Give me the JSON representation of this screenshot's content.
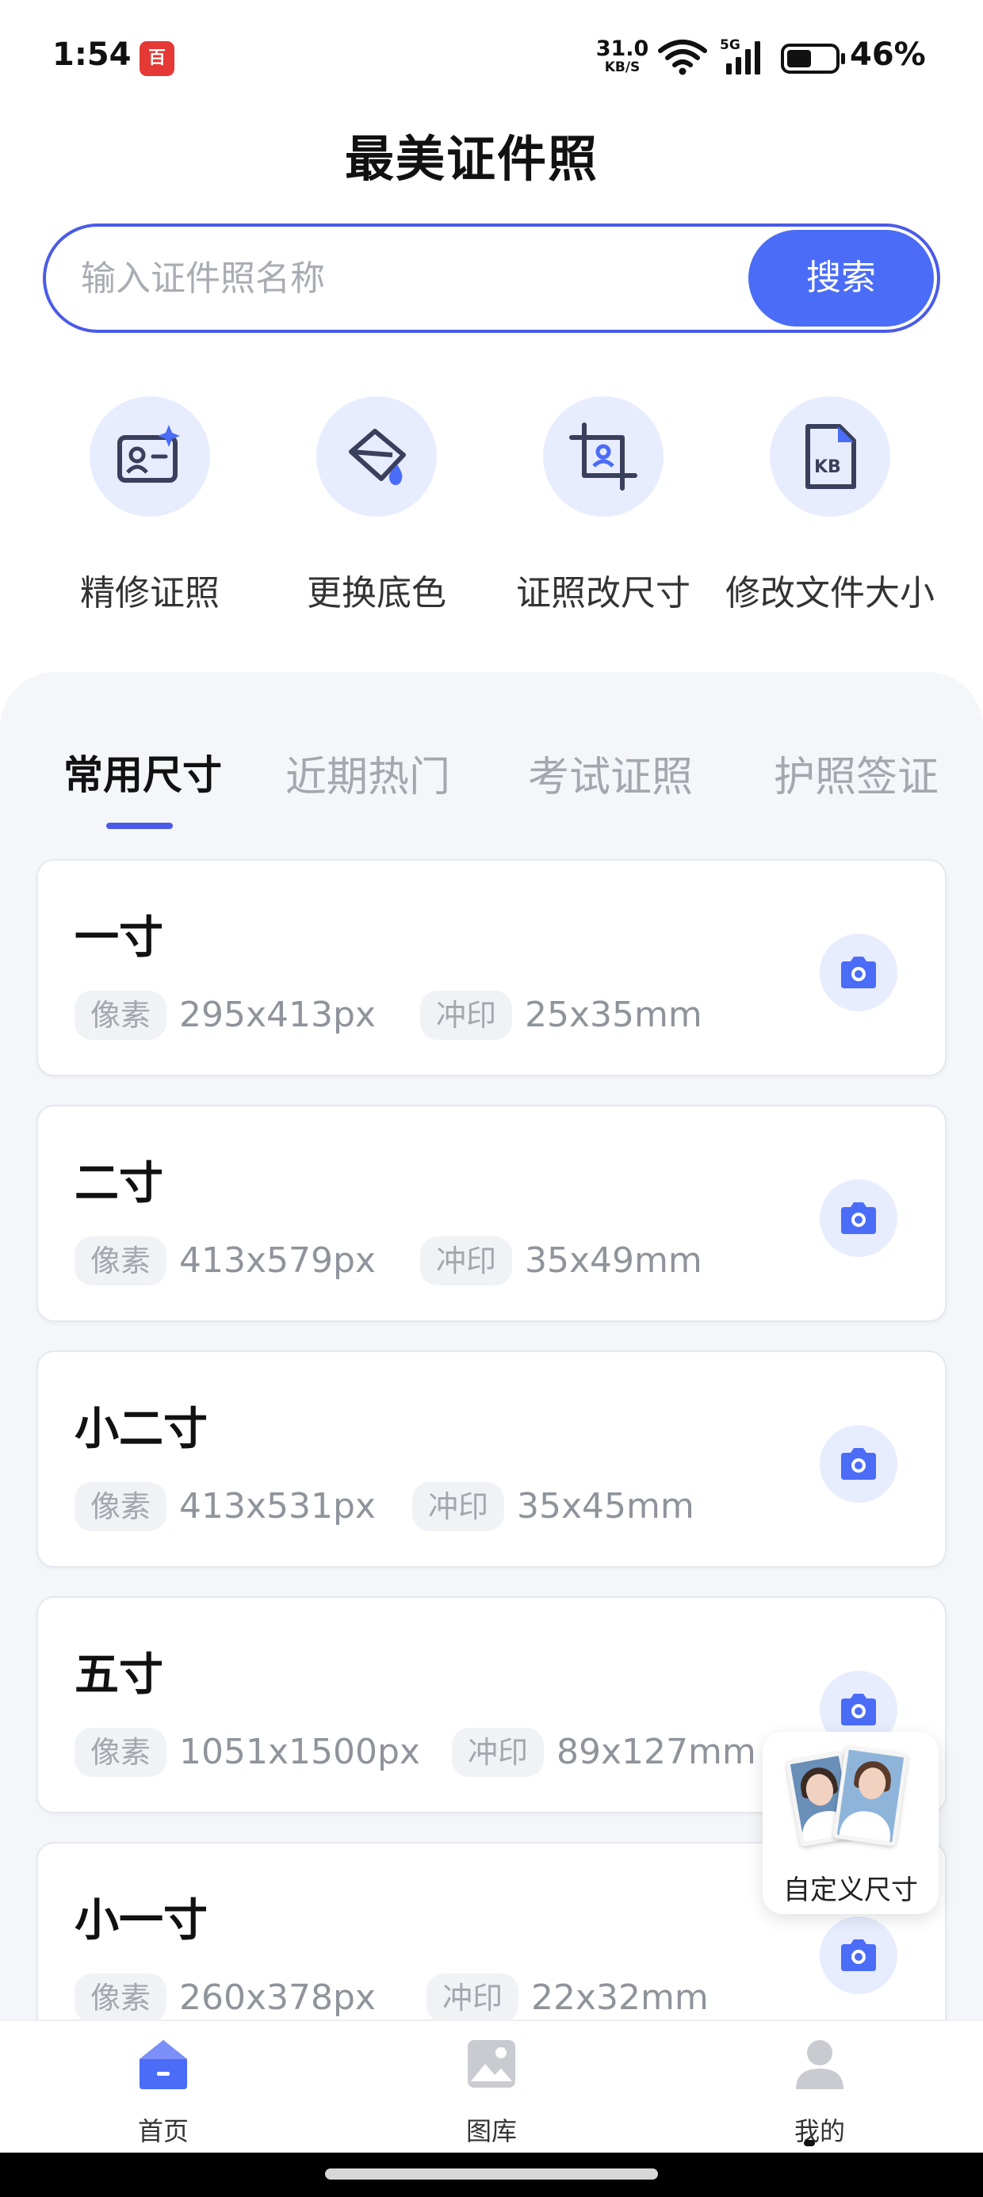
{
  "status": {
    "time": "1:54",
    "app_badge": "百",
    "net_speed_value": "31.0",
    "net_speed_unit": "KB/S",
    "network": "5G",
    "battery": "46%"
  },
  "header": {
    "title": "最美证件照"
  },
  "search": {
    "placeholder": "输入证件照名称",
    "button_label": "搜索"
  },
  "tools": [
    {
      "label": "精修证照",
      "icon": "id-card-sparkle-icon"
    },
    {
      "label": "更换底色",
      "icon": "paint-bucket-icon"
    },
    {
      "label": "证照改尺寸",
      "icon": "crop-icon"
    },
    {
      "label": "修改文件大小",
      "icon": "kb-file-icon"
    }
  ],
  "tabs": [
    {
      "label": "常用尺寸",
      "active": true
    },
    {
      "label": "近期热门",
      "active": false
    },
    {
      "label": "考试证照",
      "active": false
    },
    {
      "label": "护照签证",
      "active": false
    }
  ],
  "cards": [
    {
      "title": "一寸",
      "pixel_tag": "像素",
      "pixel": "295x413px",
      "print_tag": "冲印",
      "print": "25x35mm"
    },
    {
      "title": "二寸",
      "pixel_tag": "像素",
      "pixel": "413x579px",
      "print_tag": "冲印",
      "print": "35x49mm"
    },
    {
      "title": "小二寸",
      "pixel_tag": "像素",
      "pixel": "413x531px",
      "print_tag": "冲印",
      "print": "35x45mm"
    },
    {
      "title": "五寸",
      "pixel_tag": "像素",
      "pixel": "1051x1500px",
      "print_tag": "冲印",
      "print": "89x127mm"
    },
    {
      "title": "小一寸",
      "pixel_tag": "像素",
      "pixel": "260x378px",
      "print_tag": "冲印",
      "print": "22x32mm"
    }
  ],
  "custom_size": {
    "label": "自定义尺寸"
  },
  "bottom_nav": [
    {
      "label": "首页",
      "icon": "home-icon",
      "active": true
    },
    {
      "label": "图库",
      "icon": "gallery-icon",
      "active": false
    },
    {
      "label": "我的",
      "icon": "profile-icon",
      "active": false
    }
  ],
  "colors": {
    "accent": "#4a6cf7",
    "accent_border": "#4a5be8",
    "icon_bg": "#e8ecff",
    "panel_bg": "#f4f6fa"
  }
}
